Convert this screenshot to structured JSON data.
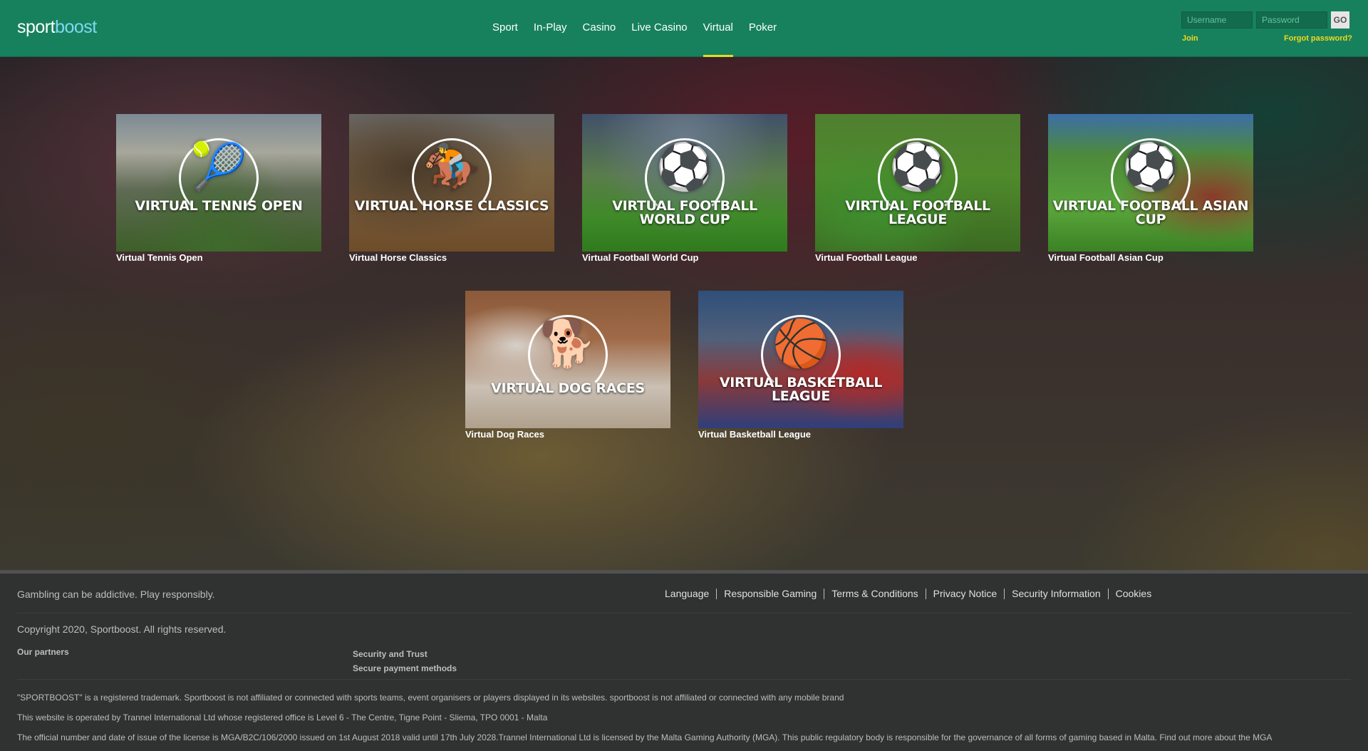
{
  "header": {
    "logo_sport": "sport",
    "logo_boost": "boost",
    "nav": [
      "Sport",
      "In-Play",
      "Casino",
      "Live Casino",
      "Virtual",
      "Poker"
    ],
    "active_nav": "Virtual",
    "login": {
      "username_placeholder": "Username",
      "password_placeholder": "Password",
      "go_label": "GO",
      "join_label": "Join",
      "forgot_label": "Forgot password?"
    }
  },
  "games": [
    {
      "overlay": "Virtual Tennis Open",
      "caption": "Virtual Tennis Open",
      "icon": "tennis-player-icon"
    },
    {
      "overlay": "Virtual Horse Classics",
      "caption": "Virtual Horse Classics",
      "icon": "horse-rider-icon"
    },
    {
      "overlay": "Virtual Football World Cup",
      "caption": "Virtual Football World Cup",
      "icon": "football-player-icon"
    },
    {
      "overlay": "Virtual Football League",
      "caption": "Virtual Football League",
      "icon": "football-player-icon"
    },
    {
      "overlay": "Virtual Football Asian Cup",
      "caption": "Virtual Football Asian Cup",
      "icon": "football-player-icon"
    },
    {
      "overlay": "Virtual Dog Races",
      "caption": "Virtual Dog Races",
      "icon": "greyhound-icon"
    },
    {
      "overlay": "Virtual Basketball League",
      "caption": "Virtual Basketball League",
      "icon": "basketball-player-icon"
    }
  ],
  "footer": {
    "tagline": "Gambling can be addictive. Play responsibly.",
    "links": [
      "Language",
      "Responsible Gaming",
      "Terms & Conditions",
      "Privacy Notice",
      "Security Information",
      "Cookies"
    ],
    "copyright": "Copyright 2020, Sportboost. All rights reserved.",
    "partners_heading": "Our partners",
    "security_heading": "Security and Trust",
    "secure_payment": "Secure payment methods",
    "legal": [
      "\"SPORTBOOST\" is a registered trademark. Sportboost is not affiliated or connected with sports teams, event organisers or players displayed in its websites. sportboost is not affiliated or connected with any mobile brand",
      "This website is operated by Trannel International Ltd whose registered office is Level 6 - The Centre, Tigne Point - Sliema, TPO 0001 - Malta",
      "The official number and date of issue of the license is MGA/B2C/106/2000 issued on 1st August 2018 valid until 17th July 2028.Trannel International Ltd is licensed by the Malta Gaming Authority (MGA). This public regulatory body is responsible for the governance of all forms of gaming based in Malta. Find out more about the MGA"
    ]
  }
}
